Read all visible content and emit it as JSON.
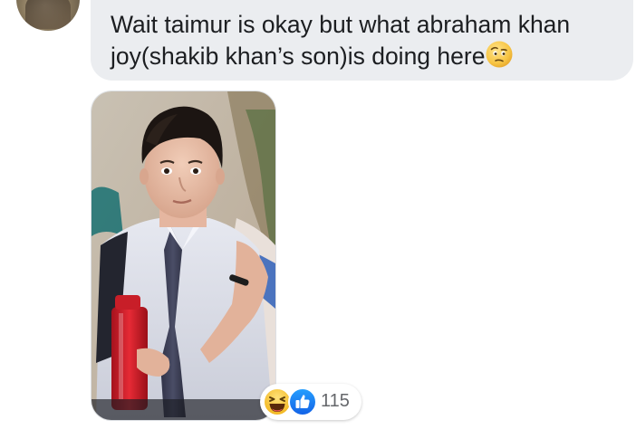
{
  "comment": {
    "text": "Wait taimur is okay but what abraham khan joy(shakib khan’s son)is doing here",
    "emoji": "face-with-raised-eyebrow-icon"
  },
  "attachment": {
    "type": "photo"
  },
  "reactions": {
    "icons": [
      "laughing-face-icon",
      "thumbs-up-like-icon"
    ],
    "count": "115"
  },
  "colors": {
    "bubble": "#ebedf0",
    "text": "#1c1e21",
    "like_blue": "#1877f2",
    "laugh_yellow": "#f7c544",
    "count_gray": "#65676b"
  }
}
